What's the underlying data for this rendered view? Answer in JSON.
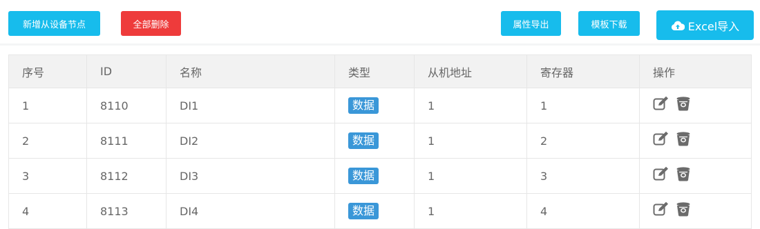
{
  "toolbar": {
    "add_from_device_label": "新增从设备节点",
    "delete_all_label": "全部删除",
    "export_attributes_label": "属性导出",
    "template_download_label": "模板下载",
    "excel_import_label": "Excel导入"
  },
  "table": {
    "headers": [
      "序号",
      "ID",
      "名称",
      "类型",
      "从机地址",
      "寄存器",
      "操作"
    ],
    "rows": [
      {
        "index": "1",
        "id": "8110",
        "name": "DI1",
        "type": "数据",
        "slave_address": "1",
        "register": "1"
      },
      {
        "index": "2",
        "id": "8111",
        "name": "DI2",
        "type": "数据",
        "slave_address": "1",
        "register": "2"
      },
      {
        "index": "3",
        "id": "8112",
        "name": "DI3",
        "type": "数据",
        "slave_address": "1",
        "register": "3"
      },
      {
        "index": "4",
        "id": "8113",
        "name": "DI4",
        "type": "数据",
        "slave_address": "1",
        "register": "4"
      }
    ],
    "row_actions": [
      "edit-icon",
      "delete-icon"
    ]
  },
  "colors": {
    "primary": "#17bcec",
    "danger": "#ee3b3b",
    "badge": "#3a97d8",
    "icon": "#6b6b6b"
  }
}
